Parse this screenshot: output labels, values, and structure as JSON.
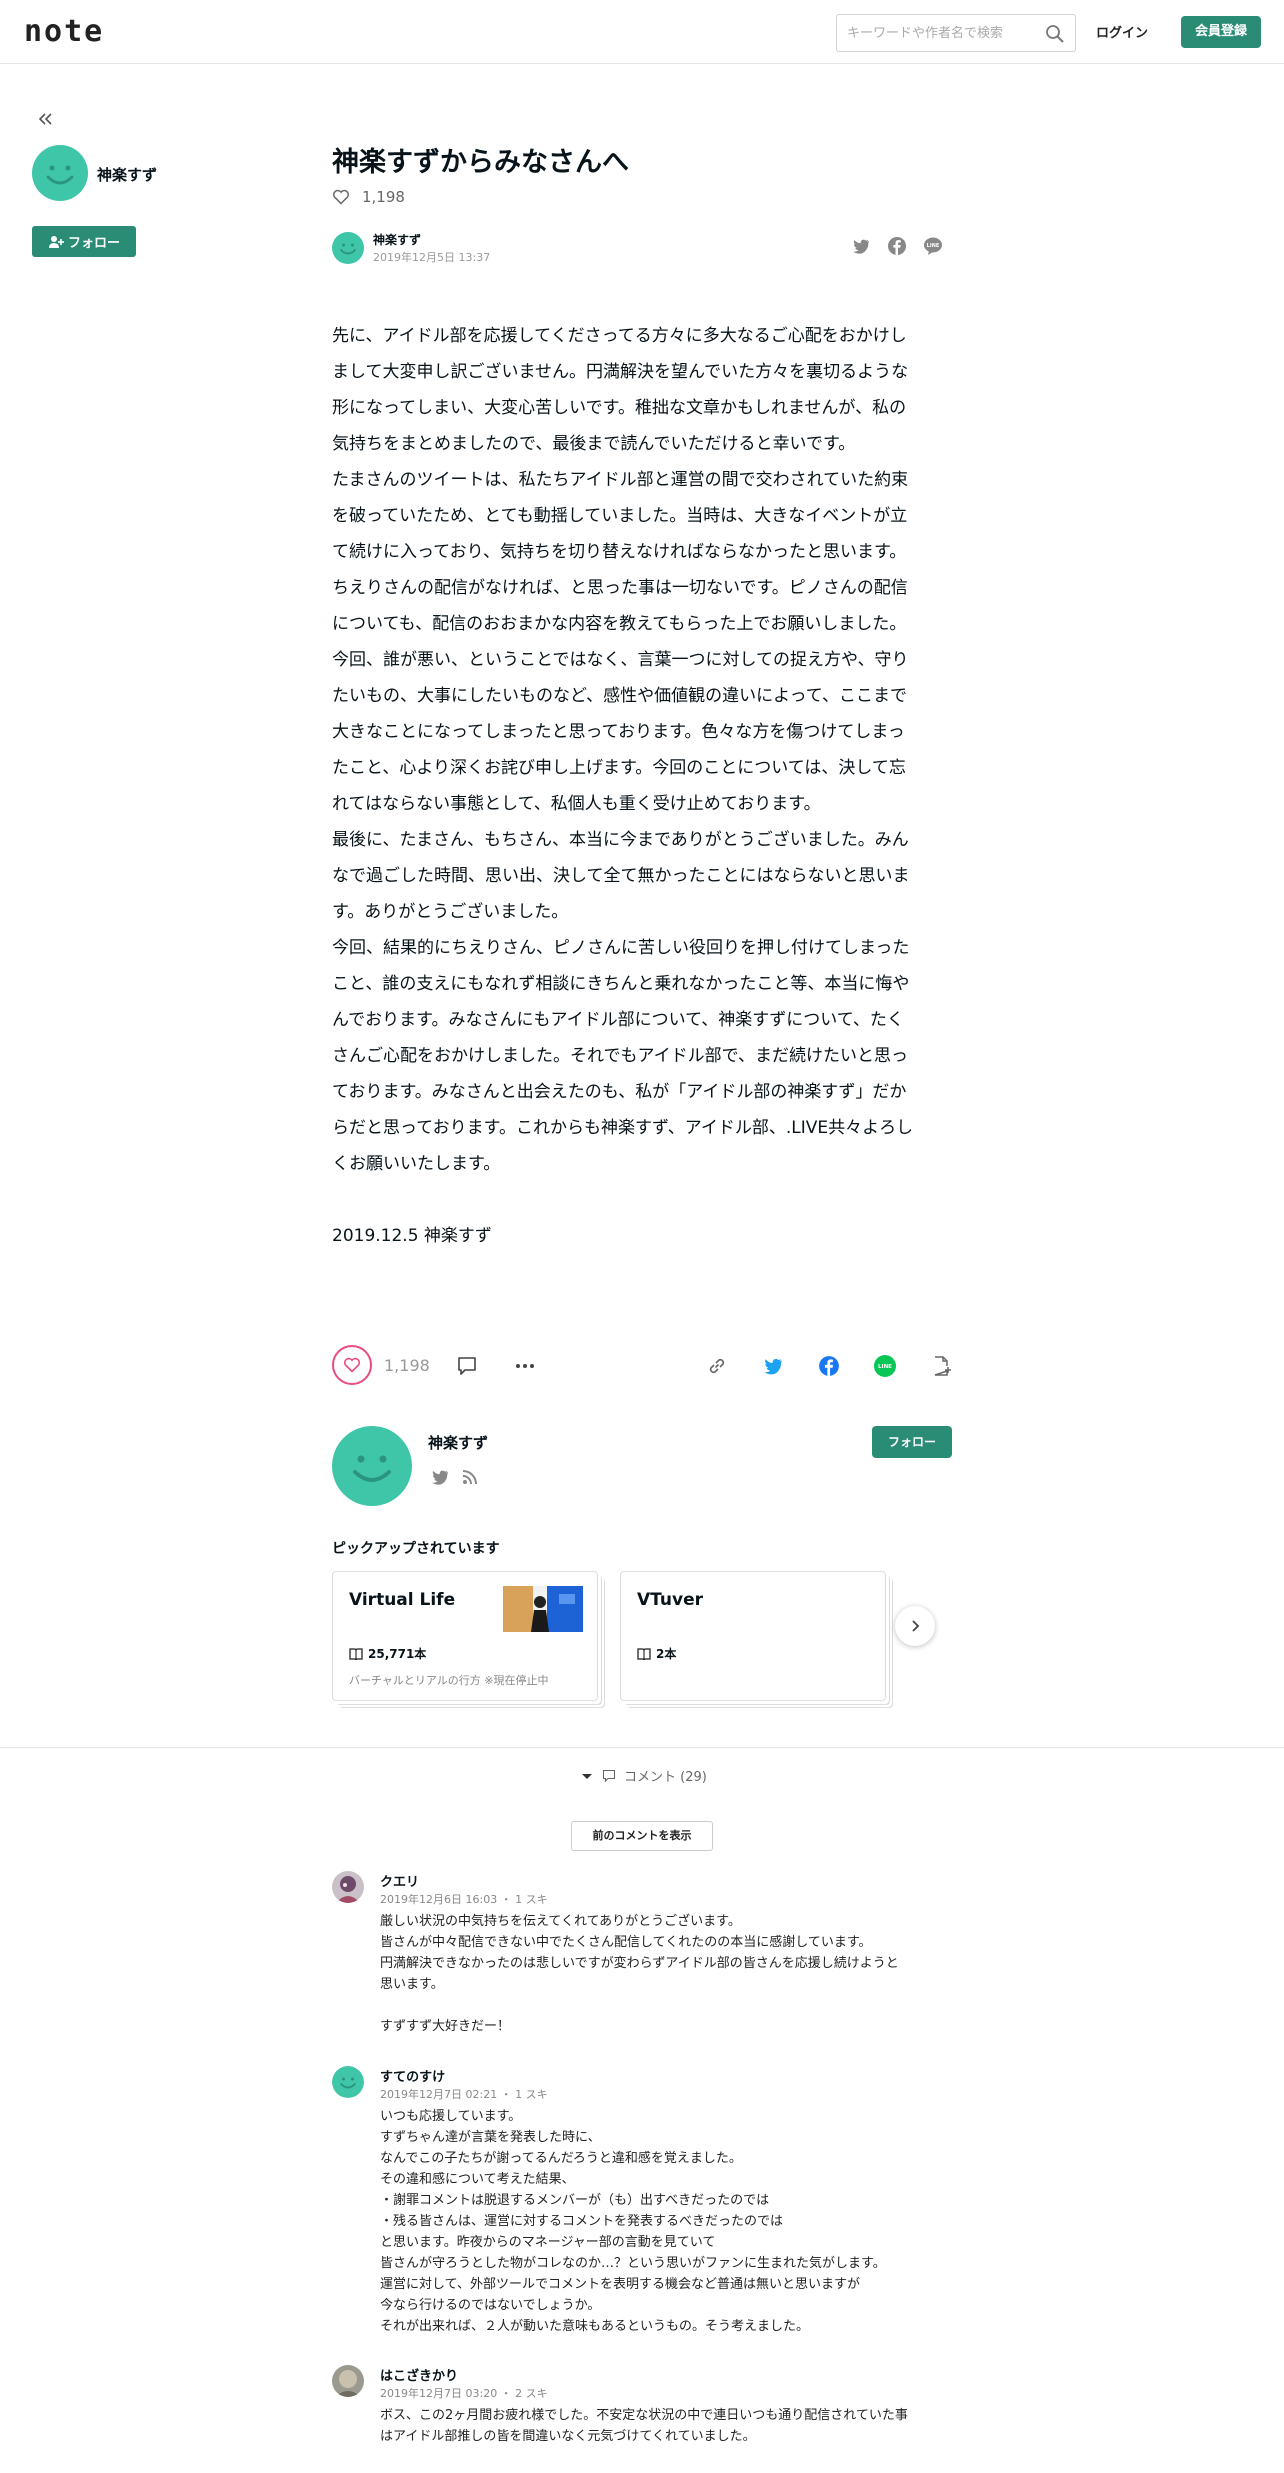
{
  "header": {
    "logo": "note",
    "search_placeholder": "キーワードや作者名で検索",
    "login_label": "ログイン",
    "register_label": "会員登録"
  },
  "sidebar": {
    "name": "神楽すず",
    "follow_label": "フォロー"
  },
  "article": {
    "title": "神楽すずからみなさんへ",
    "likes": "1,198",
    "author": "神楽すず",
    "date": "2019年12月5日 13:37",
    "paragraphs": [
      "先に、アイドル部を応援してくださってる方々に多大なるご心配をおかけし\nまして大変申し訳ございません。円満解決を望んでいた方々を裏切るような\n形になってしまい、大変心苦しいです。稚拙な文章かもしれませんが、私の\n気持ちをまとめましたので、最後まで読んでいただけると幸いです。",
      "たまさんのツイートは、私たちアイドル部と運営の間で交わされていた約束\nを破っていたため、とても動揺していました。当時は、大きなイベントが立\nて続けに入っており、気持ちを切り替えなければならなかったと思います。",
      "ちえりさんの配信がなければ、と思った事は一切ないです。ピノさんの配信\nについても、配信のおおまかな内容を教えてもらった上でお願いしました。",
      "今回、誰が悪い、ということではなく、言葉一つに対しての捉え方や、守り\nたいもの、大事にしたいものなど、感性や価値観の違いによって、ここまで\n大きなことになってしまったと思っております。色々な方を傷つけてしまっ\nたこと、心より深くお詫び申し上げます。今回のことについては、決して忘\nれてはならない事態として、私個人も重く受け止めております。",
      "最後に、たまさん、もちさん、本当に今までありがとうございました。みん\nなで過ごした時間、思い出、決して全て無かったことにはならないと思いま\nす。ありがとうございました。",
      "今回、結果的にちえりさん、ピノさんに苦しい役回りを押し付けてしまった\nこと、誰の支えにもなれず相談にきちんと乗れなかったこと等、本当に悔や\nんでおります。みなさんにもアイドル部について、神楽すずについて、たく\nさんご心配をおかけしました。それでもアイドル部で、まだ続けたいと思っ\nております。みなさんと出会えたのも、私が「アイドル部の神楽すず」だか\nらだと思っております。これからも神楽すず、アイドル部、.LIVE共々よろし\nくお願いいたします。"
    ],
    "signature": "2019.12.5 神楽すず"
  },
  "actions": {
    "likes": "1,198"
  },
  "author_card": {
    "name": "神楽すず",
    "follow_label": "フォロー"
  },
  "pickup": {
    "label": "ピックアップされています",
    "magazines": [
      {
        "title": "Virtual Life",
        "count": "25,771本",
        "desc": "バーチャルとリアルの行方 ※現在停止中"
      },
      {
        "title": "VTuver",
        "count": "2本",
        "desc": ""
      }
    ]
  },
  "comments": {
    "toggle_label": "コメント (29)",
    "prev_label": "前のコメントを表示",
    "items": [
      {
        "name": "クエリ",
        "meta": "2019年12月6日 16:03 ・ 1 スキ",
        "body": "厳しい状況の中気持ちを伝えてくれてありがとうございます。\n皆さんが中々配信できない中でたくさん配信してくれたのの本当に感謝しています。\n円満解決できなかったのは悲しいですが変わらずアイドル部の皆さんを応援し続けようと\n思います。\n\nすずすず大好きだー！"
      },
      {
        "name": "すてのすけ",
        "meta": "2019年12月7日 02:21 ・ 1 スキ",
        "body": "いつも応援しています。\nすずちゃん達が言葉を発表した時に、\nなんでこの子たちが謝ってるんだろうと違和感を覚えました。\nその違和感について考えた結果、\n・謝罪コメントは脱退するメンバーが（も）出すべきだったのでは\n・残る皆さんは、運営に対するコメントを発表するべきだったのでは\nと思います。昨夜からのマネージャー部の言動を見ていて\n皆さんが守ろうとした物がコレなのか…？という思いがファンに生まれた気がします。\n運営に対して、外部ツールでコメントを表明する機会など普通は無いと思いますが\n今なら行けるのではないでしょうか。\nそれが出来れば、２人が動いた意味もあるというもの。そう考えました。"
      },
      {
        "name": "はこざきかり",
        "meta": "2019年12月7日 03:20 ・ 2 スキ",
        "body": "ボス、この2ヶ月間お疲れ様でした。不安定な状況の中で連日いつも通り配信されていた事\nはアイドル部推しの皆を間違いなく元気づけてくれていました。"
      }
    ]
  },
  "colors": {
    "brand_green": "#2b8c76",
    "avatar_teal": "#3fc5a8",
    "like_pink": "#e94b83",
    "twitter_blue": "#1da1f2",
    "facebook_blue": "#1877f2",
    "line_green": "#06c755"
  }
}
